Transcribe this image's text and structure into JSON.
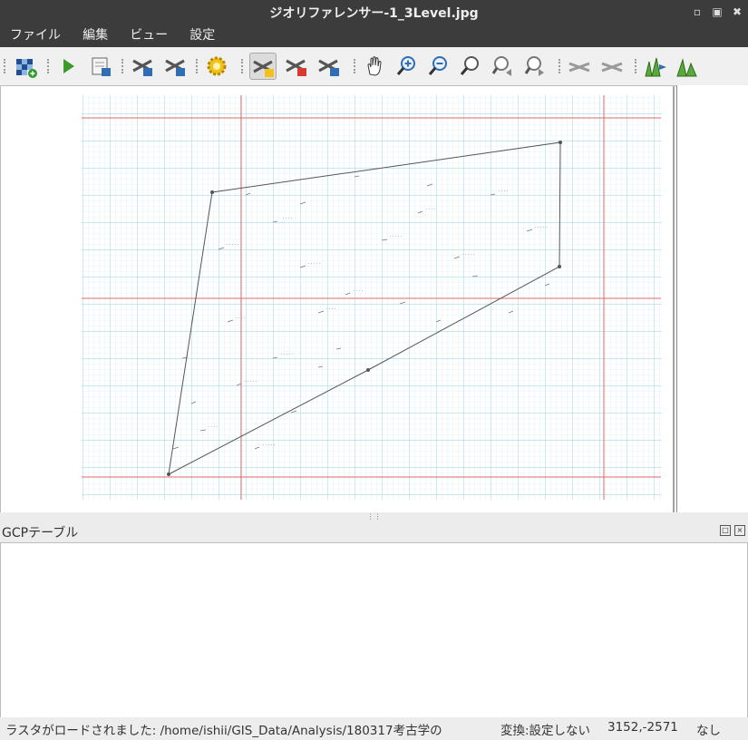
{
  "window": {
    "title": "ジオリファレンサー-1_3Level.jpg"
  },
  "menu": [
    "ファイル",
    "編集",
    "ビュー",
    "設定"
  ],
  "toolbar": {
    "buttons": [
      {
        "name": "open-raster-button"
      },
      {
        "name": "start-georeferencing-button"
      },
      {
        "name": "generate-gdal-script-button"
      },
      {
        "name": "load-gcp-points-button"
      },
      {
        "name": "save-gcp-points-button"
      },
      {
        "name": "transformation-settings-button"
      },
      {
        "name": "add-point-button"
      },
      {
        "name": "delete-point-button"
      },
      {
        "name": "move-gcp-point-button"
      },
      {
        "name": "pan-button"
      },
      {
        "name": "zoom-in-button"
      },
      {
        "name": "zoom-out-button"
      },
      {
        "name": "zoom-to-layer-button"
      },
      {
        "name": "zoom-last-button"
      },
      {
        "name": "zoom-next-button"
      },
      {
        "name": "link-georeferencer-to-qgis-button"
      },
      {
        "name": "link-qgis-to-georeferencer-button"
      },
      {
        "name": "full-histogram-stretch-button"
      },
      {
        "name": "local-histogram-stretch-button"
      }
    ]
  },
  "gcp_panel": {
    "title": "GCPテーブル"
  },
  "status": {
    "message": "ラスタがロードされました: /home/ishii/GIS_Data/Analysis/180317考古学の",
    "transform": "変換:設定しない",
    "coords": "3152,-2571",
    "crs": "なし"
  },
  "colors": {
    "titlebar_bg": "#3c3c3c",
    "grid_cyan": "#aee0ec",
    "grid_red": "#e26a6a",
    "pencil": "#555555"
  }
}
